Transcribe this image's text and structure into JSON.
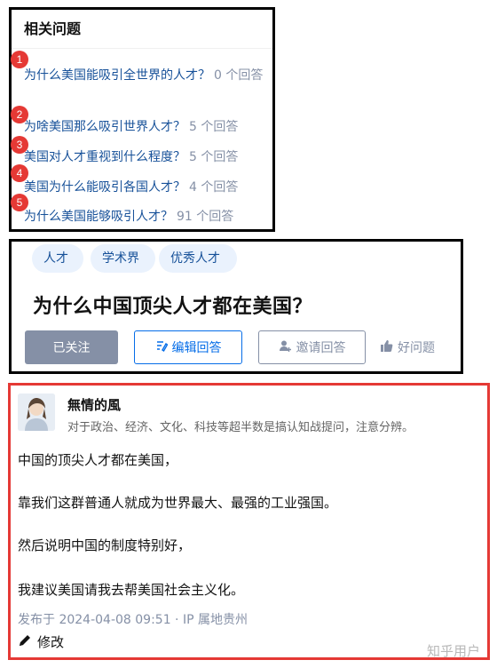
{
  "related": {
    "title": "相关问题",
    "items": [
      {
        "badge": "1",
        "question": "为什么美国能吸引全世界的人才？",
        "count": "0 个回答"
      },
      {
        "badge": "2",
        "question": "为啥美国那么吸引世界人才？",
        "count": "5 个回答"
      },
      {
        "badge": "3",
        "question": "美国对人才重视到什么程度？",
        "count": "5 个回答"
      },
      {
        "badge": "4",
        "question": "美国为什么能吸引各国人才？",
        "count": "4 个回答"
      },
      {
        "badge": "5",
        "question": "为什么美国能够吸引人才？",
        "count": "91 个回答"
      }
    ]
  },
  "question": {
    "tags": [
      "人才",
      "学术界",
      "优秀人才"
    ],
    "title": "为什么中国顶尖人才都在美国？",
    "buttons": {
      "followed": "已关注",
      "edit_answer": "编辑回答",
      "invite_answer": "邀请回答",
      "good_question": "好问题"
    }
  },
  "answer": {
    "author": "無情的風",
    "bio": "对于政治、经济、文化、科技等超半数是搞认知战提问，注意分辨。",
    "paragraphs": [
      "中国的顶尖人才都在美国，",
      "靠我们这群普通人就成为世界最大、最强的工业强国。",
      "然后说明中国的制度特别好，",
      "我建议美国请我去帮美国社会主义化。"
    ],
    "meta": "发布于 2024-04-08 09:51 · IP 属地贵州",
    "edit_label": "修改",
    "watermark": "知乎用户"
  },
  "colors": {
    "link": "#175199",
    "muted": "#8590a6",
    "brand_blue": "#056de8",
    "badge_red": "#e53935",
    "tag_bg": "#eaf2fd"
  }
}
